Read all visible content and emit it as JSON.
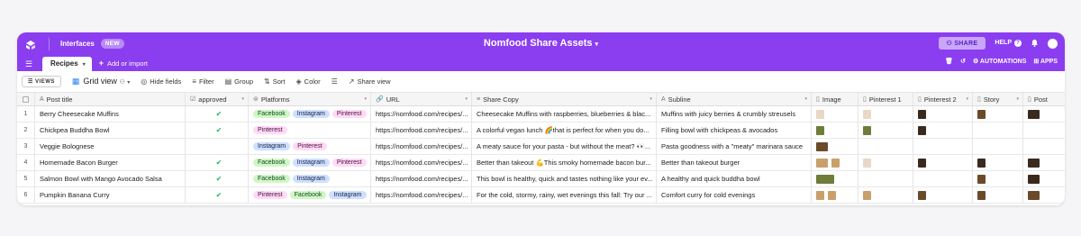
{
  "app": {
    "interfaces_label": "Interfaces",
    "new_badge": "NEW",
    "base_title": "Nomfood Share Assets",
    "share_label": "SHARE",
    "help_label": "HELP",
    "help_glyph": "?"
  },
  "tabs": {
    "active_tab": "Recipes",
    "add_import": "Add or import",
    "automations": "AUTOMATIONS",
    "apps": "APPS"
  },
  "toolbar": {
    "views": "VIEWS",
    "grid_view": "Grid view",
    "hide_fields": "Hide fields",
    "filter": "Filter",
    "group": "Group",
    "sort": "Sort",
    "color": "Color",
    "share_view": "Share view"
  },
  "columns": {
    "post_title": "Post title",
    "approved": "approved",
    "platforms": "Platforms",
    "url": "URL",
    "share_copy": "Share Copy",
    "subline": "Subline",
    "image": "Image",
    "pinterest1": "Pinterest 1",
    "pinterest2": "Pinterest 2",
    "story": "Story",
    "post": "Post"
  },
  "rows": [
    {
      "num": "1",
      "title": "Berry Cheesecake Muffins",
      "approved": "✔",
      "url": "https://nomfood.com/recipes/...",
      "copy": "Cheesecake Muffins with raspberries, blueberries & blac...",
      "subline": "Muffins with juicy berries & crumbly streusels"
    },
    {
      "num": "2",
      "title": "Chickpea Buddha Bowl",
      "approved": "✔",
      "url": "https://nomfood.com/recipes/...",
      "copy": "A colorful vegan lunch 🌈that is perfect for when you do...",
      "subline": "Filling bowl with chickpeas & avocados"
    },
    {
      "num": "3",
      "title": "Veggie Bolognese",
      "approved": "",
      "url": "https://nomfood.com/recipes/...",
      "copy": "A meaty sauce for your pasta - but without the meat? 👀...",
      "subline": "Pasta goodness with a \"meaty\" marinara sauce"
    },
    {
      "num": "4",
      "title": "Homemade Bacon Burger",
      "approved": "✔",
      "url": "https://nomfood.com/recipes/...",
      "copy": "Better than takeout 💪This smoky homemade bacon bur...",
      "subline": "Better than takeout burger"
    },
    {
      "num": "5",
      "title": "Salmon Bowl with Mango Avocado Salsa",
      "approved": "✔",
      "url": "https://nomfood.com/recipes/...",
      "copy": "This bowl is healthy, quick and tastes nothing like your ev...",
      "subline": "A healthy and quick buddha bowl"
    },
    {
      "num": "6",
      "title": "Pumpkin Banana Curry",
      "approved": "✔",
      "url": "https://nomfood.com/recipes/...",
      "copy": "For the cold, stormy, rainy, wet evenings this fall: Try our ...",
      "subline": "Comfort curry for cold evenings"
    }
  ],
  "platform_tags": {
    "facebook": "Facebook",
    "instagram": "Instagram",
    "pinterest": "Pinterest"
  },
  "colors": {
    "brand_purple": "#8b3ef0",
    "check_green": "#2fb256",
    "facebook_tag": "#d1f7c4",
    "instagram_tag": "#cfdfff",
    "pinterest_tag": "#ffdaf6"
  }
}
